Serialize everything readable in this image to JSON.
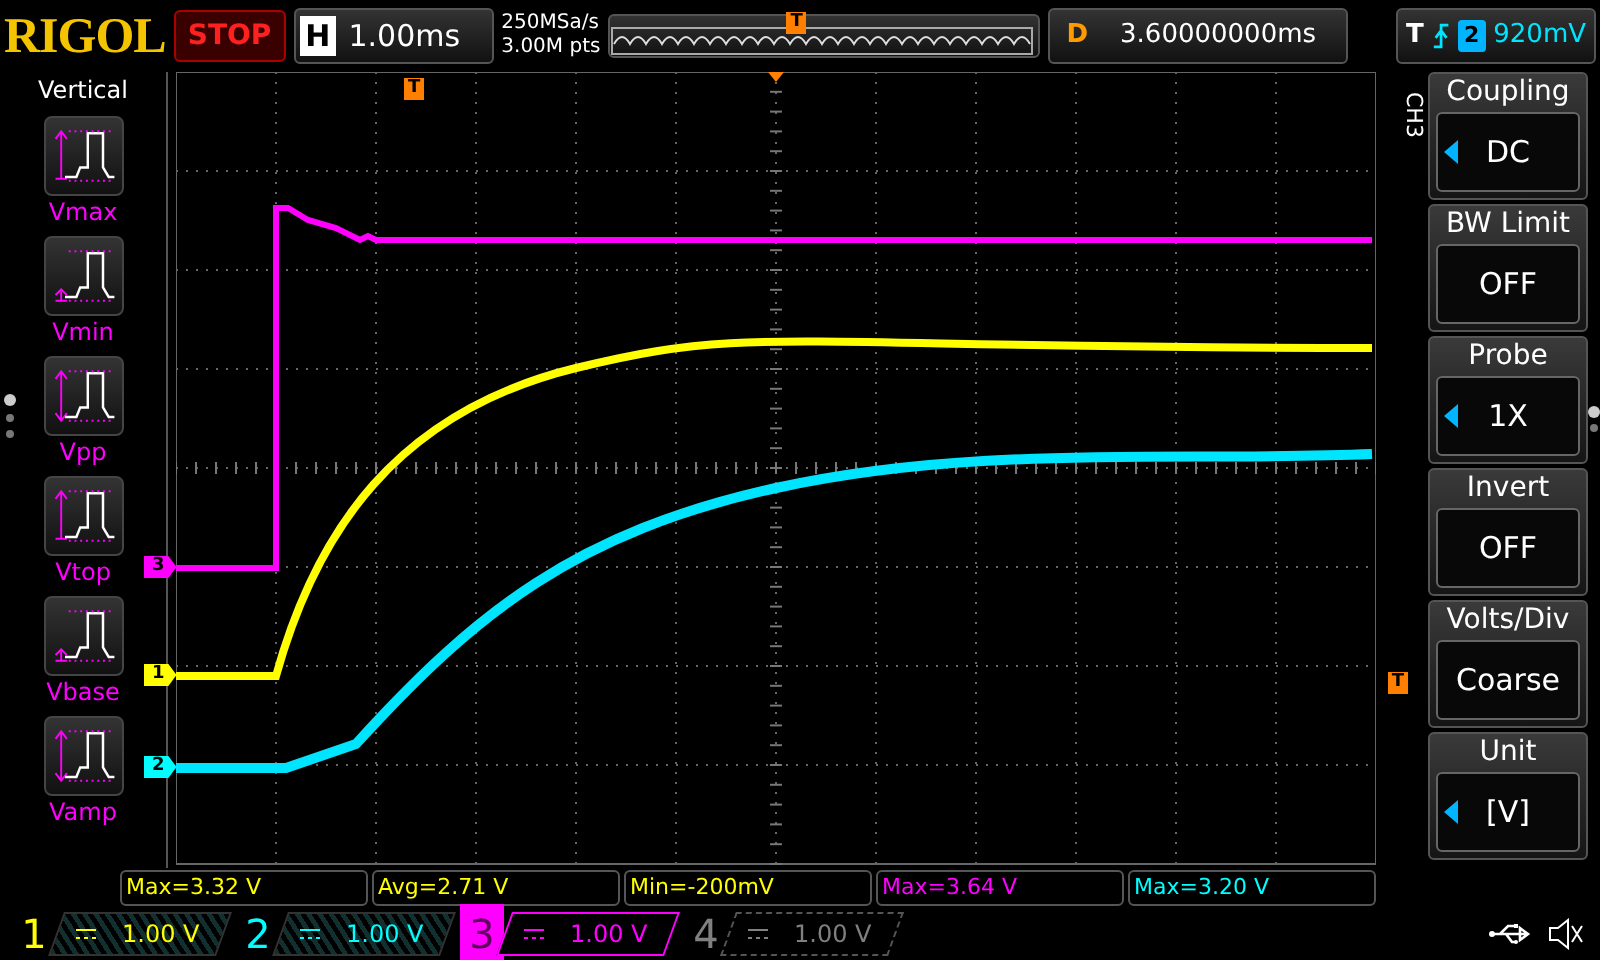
{
  "top_bar": {
    "brand": "RIGOL",
    "run_state": "STOP",
    "timebase": {
      "label": "H",
      "value": "1.00ms"
    },
    "sample_rate": "250MSa/s",
    "memory_depth": "3.00M pts",
    "trigger_marker": "T",
    "delay": {
      "label": "D",
      "value": "3.60000000ms"
    },
    "trigger": {
      "label": "T",
      "source": "2",
      "level": "920mV"
    }
  },
  "left_menu": {
    "title": "Vertical",
    "items": [
      {
        "label": "Vmax",
        "kind": "max"
      },
      {
        "label": "Vmin",
        "kind": "min"
      },
      {
        "label": "Vpp",
        "kind": "pp"
      },
      {
        "label": "Vtop",
        "kind": "max"
      },
      {
        "label": "Vbase",
        "kind": "min"
      },
      {
        "label": "Vamp",
        "kind": "pp"
      }
    ]
  },
  "screen": {
    "trigger_marker": "T",
    "level_marker": "T",
    "channel_markers": [
      {
        "label": "3",
        "color": "#ff00ff"
      },
      {
        "label": "1",
        "color": "#ffff00"
      },
      {
        "label": "2",
        "color": "#00ffff"
      }
    ]
  },
  "right_menu": {
    "channel": "CH3",
    "items": [
      {
        "title": "Coupling",
        "value": "DC",
        "adjustable": true
      },
      {
        "title": "BW Limit",
        "value": "OFF",
        "adjustable": false
      },
      {
        "title": "Probe",
        "value": "1X",
        "adjustable": true
      },
      {
        "title": "Invert",
        "value": "OFF",
        "adjustable": false
      },
      {
        "title": "Volts/Div",
        "value": "Coarse",
        "adjustable": false
      },
      {
        "title": "Unit",
        "value": "[V]",
        "adjustable": true
      }
    ]
  },
  "measurements": [
    {
      "text": "Max=3.32 V",
      "color": "#ffff00"
    },
    {
      "text": "Avg=2.71 V",
      "color": "#ffff00"
    },
    {
      "text": "Min=-200mV",
      "color": "#ffff00"
    },
    {
      "text": "Max=3.64 V",
      "color": "#ff00ff"
    },
    {
      "text": "Max=3.20 V",
      "color": "#00ffff"
    }
  ],
  "channels": [
    {
      "number": "1",
      "scale": "1.00 V",
      "color": "#ffff00",
      "selected": false,
      "on": true
    },
    {
      "number": "2",
      "scale": "1.00 V",
      "color": "#00ffff",
      "selected": false,
      "on": true
    },
    {
      "number": "3",
      "scale": "1.00 V",
      "color": "#ff00ff",
      "selected": true,
      "on": true
    },
    {
      "number": "4",
      "scale": "1.00 V",
      "color": "#808080",
      "selected": false,
      "on": false
    }
  ]
}
